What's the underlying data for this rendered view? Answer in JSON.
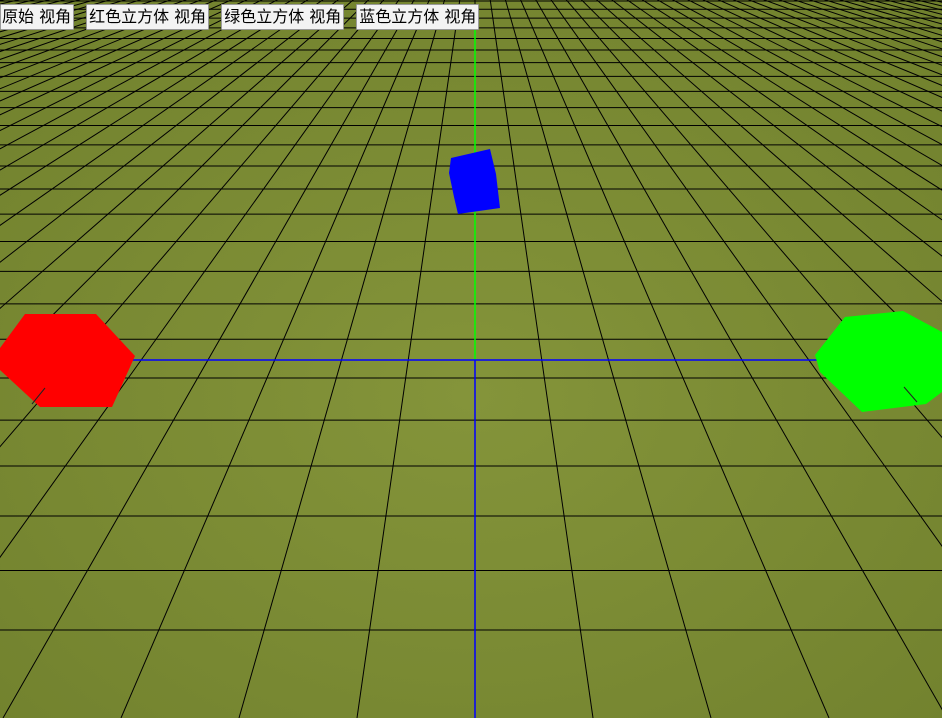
{
  "toolbar": {
    "buttons": [
      {
        "label": "原始 视角"
      },
      {
        "label": "红色立方体 视角"
      },
      {
        "label": "绿色立方体 视角"
      },
      {
        "label": "蓝色立方体 视角"
      }
    ]
  },
  "scene": {
    "ground_color": "#7b8b34",
    "grid_line_color": "#000000",
    "axis_vertical_color": "#00ff00",
    "axis_horizontal_color": "#0000ff",
    "cubes": [
      {
        "name": "red-cube",
        "color": "#ff0000"
      },
      {
        "name": "green-cube",
        "color": "#00ff00"
      },
      {
        "name": "blue-cube",
        "color": "#0000ff"
      }
    ]
  }
}
